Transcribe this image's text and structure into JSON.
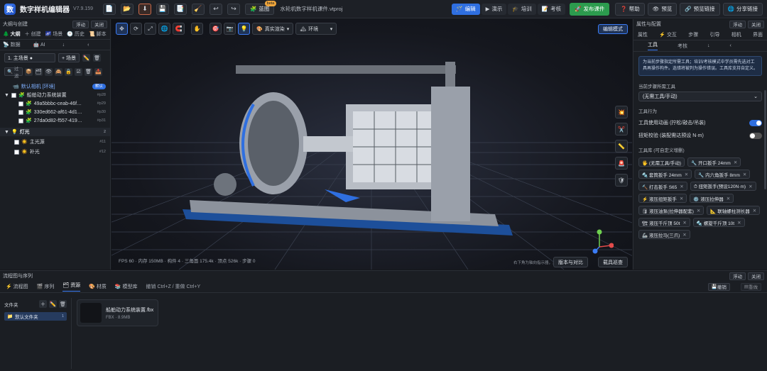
{
  "app": {
    "logo": "数",
    "title": "数字样机编辑器",
    "version": "V7.9.159",
    "filename": "水轮机数字样机课件.vtproj"
  },
  "toolbar": {
    "icons": [
      {
        "name": "new-file-icon",
        "glyph": "📄"
      },
      {
        "name": "open-folder-icon",
        "glyph": "📂"
      },
      {
        "name": "download-icon",
        "glyph": "⬇"
      },
      {
        "name": "save-icon",
        "glyph": "💾"
      },
      {
        "name": "copy-icon",
        "glyph": "📑"
      },
      {
        "name": "brush-icon",
        "glyph": "🧹"
      },
      {
        "name": "undo-icon",
        "glyph": "↩"
      },
      {
        "name": "redo-icon",
        "glyph": "↪"
      }
    ],
    "blueprint_label": "蓝图",
    "beta": "beta"
  },
  "modes": [
    {
      "icon": "🪄",
      "label": "编辑",
      "active": true
    },
    {
      "icon": "▶",
      "label": "演示",
      "active": false
    },
    {
      "icon": "🎓",
      "label": "培训",
      "active": false
    },
    {
      "icon": "📝",
      "label": "考核",
      "active": false
    }
  ],
  "actions": {
    "publish": "发布课件",
    "help": "帮助",
    "preview": "预览",
    "preview_link": "预览链接",
    "share_link": "分享链接"
  },
  "left": {
    "header": "大纲与创建",
    "float": "浮动",
    "close": "关闭",
    "tabs": [
      "大纲",
      "创建",
      "场景",
      "历史",
      "脚本"
    ],
    "subtabs": [
      "数据",
      "AI"
    ],
    "scene_select": "1. 主场景 ●",
    "add_scene": "+ 场景",
    "filter": "过滤",
    "tree": [
      {
        "label": "默认相机 [环境]",
        "badge": "默认",
        "level": 0,
        "type": "camera"
      },
      {
        "label": "船舶动力系统装置",
        "count": "#p28",
        "level": 0,
        "type": "group"
      },
      {
        "label": "49a5bbbc-ceab-46f…",
        "count": "#p29",
        "level": 1,
        "type": "mesh"
      },
      {
        "label": "330ed662-af61-4d1…",
        "count": "#p30",
        "level": 1,
        "type": "mesh"
      },
      {
        "label": "27da0d82-f557-419…",
        "count": "#p31",
        "level": 1,
        "type": "mesh"
      },
      {
        "label": "灯光",
        "count": "2",
        "level": 0,
        "type": "lights"
      },
      {
        "label": "主光源",
        "count": "#11",
        "level": 1,
        "type": "light"
      },
      {
        "label": "补光",
        "count": "#12",
        "level": 1,
        "type": "light"
      }
    ]
  },
  "viewport": {
    "render_mode": "真实渲染",
    "environment": "环境",
    "edit_mode": "编辑模式",
    "stats": "FPS 60 · 内存 150MB · 构件 4 · 三角面 175.4k · 顶点 526k · 步骤 0",
    "hint": "右下角为轴向指示器，点击轴…",
    "compare": "版本与对比",
    "inspect": "载具巡查"
  },
  "right": {
    "header": "属性与配置",
    "float": "浮动",
    "close": "关闭",
    "tabs": [
      "属性",
      "交互",
      "步骤",
      "引导",
      "相机",
      "界面"
    ],
    "subtabs": [
      "工具",
      "考核"
    ],
    "note": "为当前步骤指定所需工具；培训/考核模式中学员需先选对工具再操作构件。选错将被判为操作错误。工具库支持自定义。",
    "required_tool_label": "当前步骤所需工具",
    "required_tool_value": "(无需工具/手动)",
    "behavior_label": "工具行为",
    "toggle1": "工具使用动画 (拧松/敲击/吊装)",
    "toggle1_on": true,
    "toggle2": "扭矩校验 (装配需达预设 N·m)",
    "toggle2_on": false,
    "library_label": "工具库 (可自定义增删)",
    "chips": [
      "🖐 (无需工具/手动)",
      "🔧 开口扳手 24mm",
      "🔩 套筒扳手 24mm",
      "🔧 内六角扳手 8mm",
      "🔨 打击扳手 S65",
      "⏱ 扭矩扳手(预设120N·m)",
      "⚡ 液压扭矩扳手",
      "⚙️ 液压拉伸器",
      "🛢 液压油泵(拉伸器配套)",
      "📐 联轴螺柱测长器",
      "🏗 液压千斤顶 50t",
      "🔩 螺旋千斤顶 10t",
      "🦾 液压拉马(三爪)"
    ]
  },
  "bottom": {
    "header": "流程图与序列",
    "float": "浮动",
    "close": "关闭",
    "tabs": [
      "流程图",
      "序列",
      "资源",
      "材质",
      "模型库"
    ],
    "shortcut": "撤销 Ctrl+Z / 重做 Ctrl+Y",
    "undo": "撤销",
    "redo": "重做",
    "folders_label": "文件夹",
    "folder": "默认文件夹",
    "folder_count": "1",
    "asset_name": "船舶动力系统装置.fbx",
    "asset_meta": "FBX · 8.9MB"
  }
}
